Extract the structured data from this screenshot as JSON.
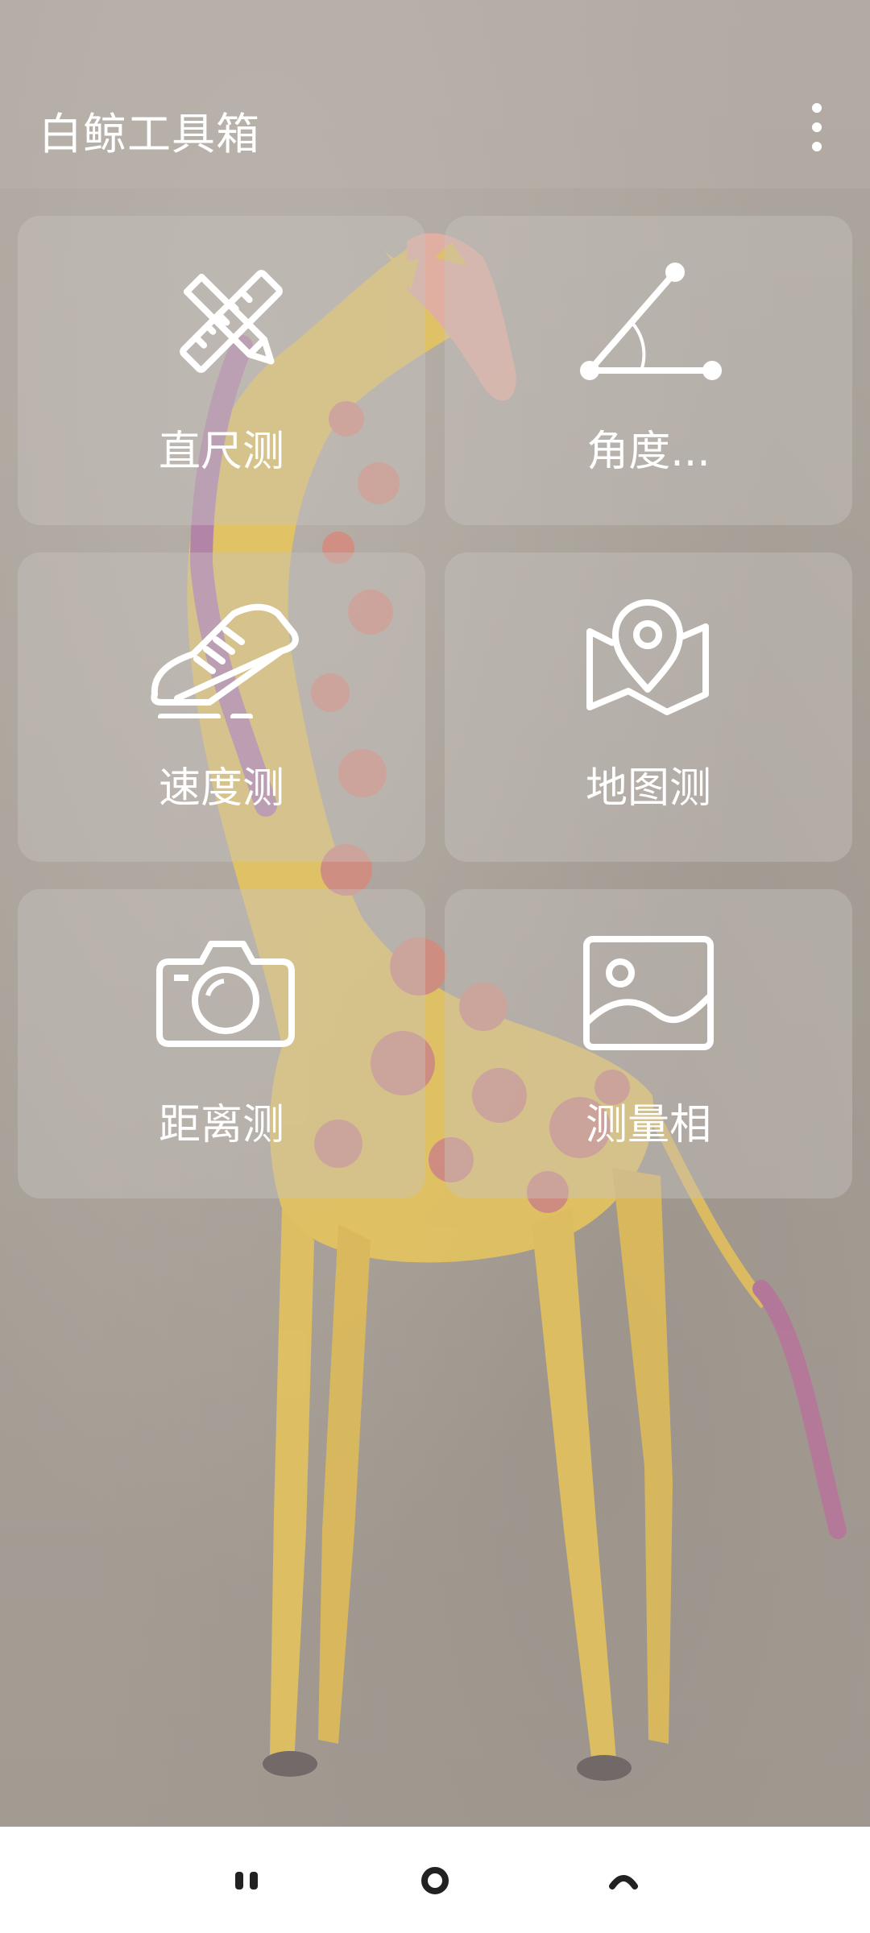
{
  "app": {
    "title": "白鲸工具箱"
  },
  "menu": {
    "icon": "more-vertical-icon"
  },
  "tools": [
    {
      "label": "直尺测",
      "icon": "ruler-pencil-icon"
    },
    {
      "label": "角度...",
      "icon": "angle-icon"
    },
    {
      "label": "速度测",
      "icon": "sneaker-icon"
    },
    {
      "label": "地图测",
      "icon": "map-pin-icon"
    },
    {
      "label": "距离测",
      "icon": "camera-icon"
    },
    {
      "label": "测量相",
      "icon": "image-icon"
    }
  ],
  "navigation": {
    "recent": "recent-apps-icon",
    "home": "home-icon",
    "back": "back-icon"
  },
  "colors": {
    "card_text": "#ffffff",
    "icon_stroke": "#ffffff",
    "nav_bar": "#ffffff",
    "nav_icon": "#222222"
  }
}
